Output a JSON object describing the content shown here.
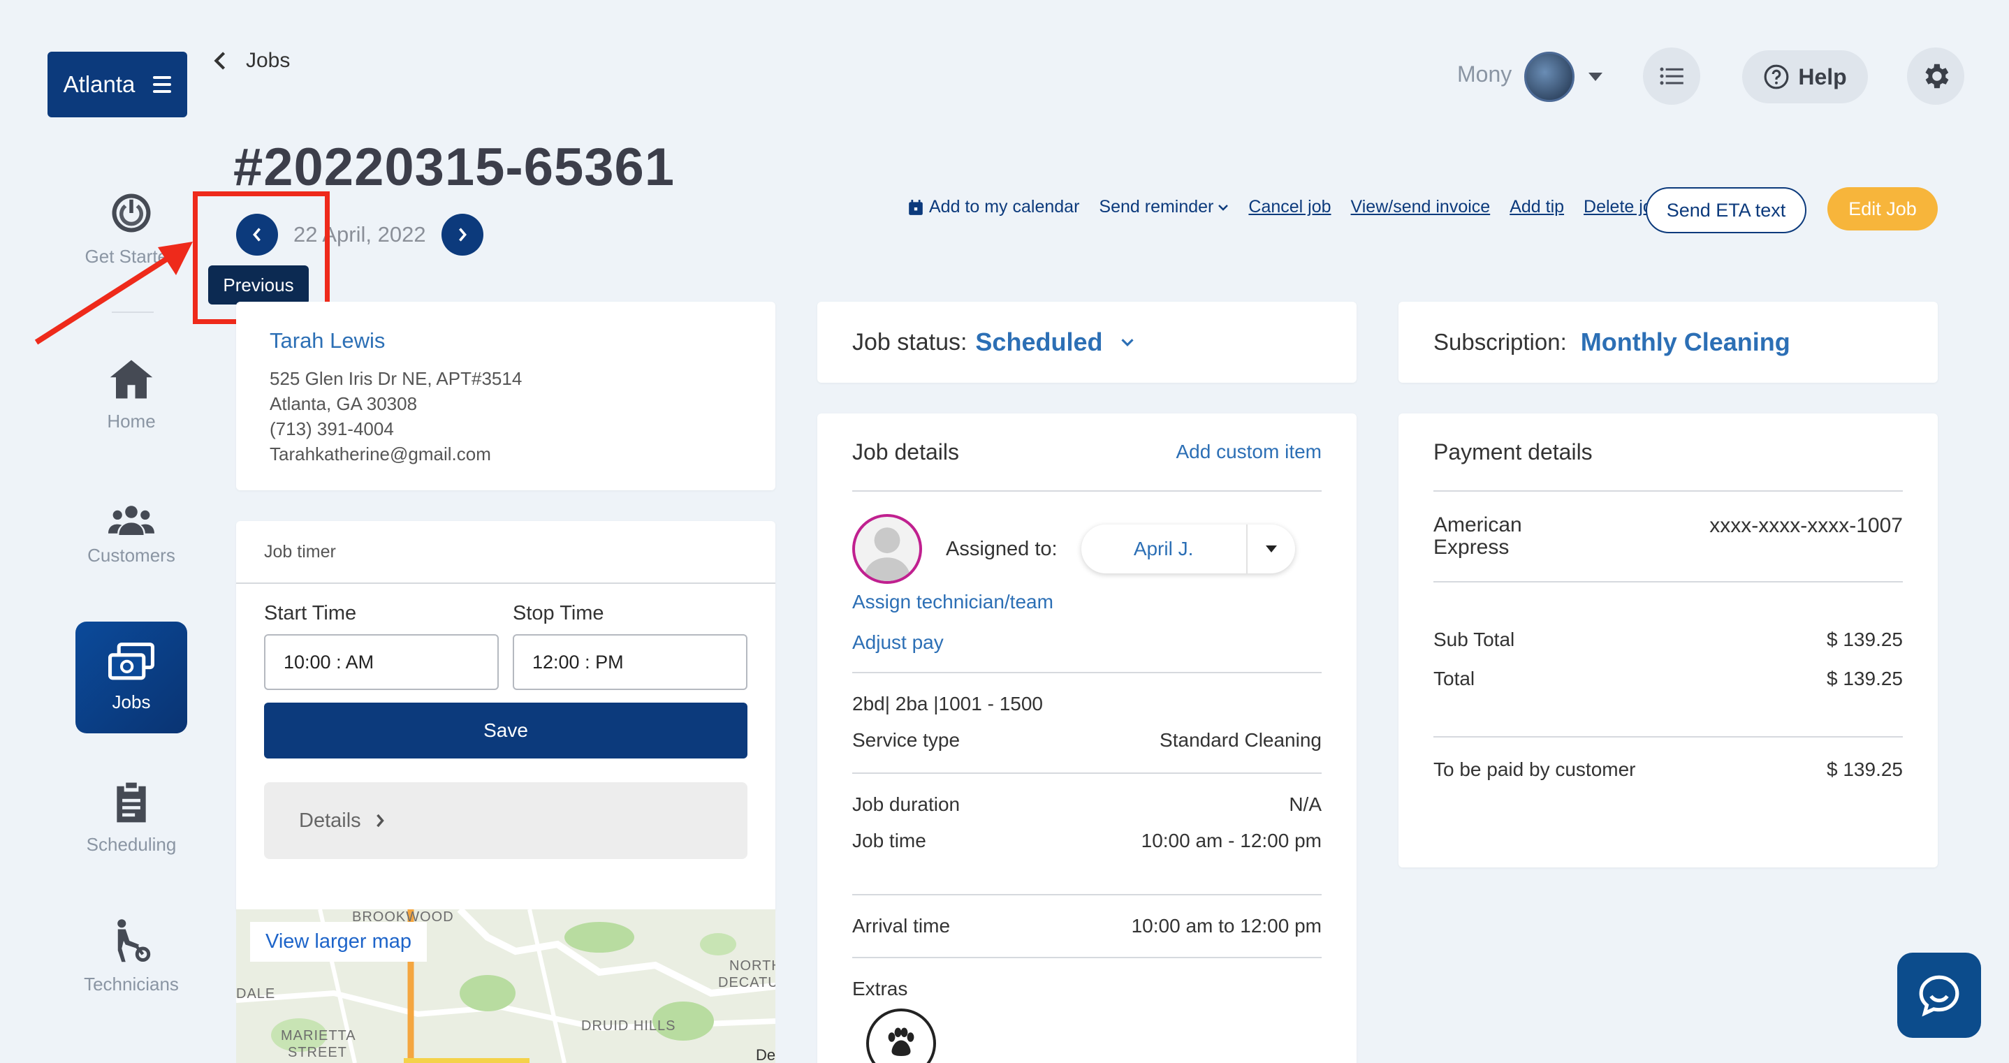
{
  "brand": {
    "label": "Atlanta",
    "icon": "menu-icon"
  },
  "sidebar": {
    "items": [
      {
        "label": "Get Started",
        "icon": "power-icon"
      },
      {
        "label": "Home",
        "icon": "home-icon"
      },
      {
        "label": "Customers",
        "icon": "customers-icon"
      },
      {
        "label": "Jobs",
        "icon": "jobs-icon",
        "active": true
      },
      {
        "label": "Scheduling",
        "icon": "clipboard-icon"
      },
      {
        "label": "Technicians",
        "icon": "technician-icon"
      }
    ]
  },
  "header": {
    "back_label": "Jobs",
    "user_name": "Mony",
    "help_label": "Help"
  },
  "job": {
    "id": "#20220315-65361",
    "date": "22 April, 2022",
    "tooltip": "Previous"
  },
  "actions": {
    "add_calendar": "Add to my calendar",
    "send_reminder": "Send reminder",
    "cancel_job": "Cancel job",
    "view_invoice": "View/send invoice",
    "add_tip": "Add tip",
    "delete_job": "Delete job",
    "send_eta": "Send ETA text",
    "edit_job": "Edit Job"
  },
  "customer": {
    "name": "Tarah Lewis",
    "address1": "525 Glen Iris Dr NE, APT#3514",
    "address2": "Atlanta, GA 30308",
    "phone": "(713) 391-4004",
    "email": "Tarahkatherine@gmail.com"
  },
  "timer": {
    "title": "Job timer",
    "start_label": "Start Time",
    "start_value": "10:00 : AM",
    "stop_label": "Stop Time",
    "stop_value": "12:00 : PM",
    "save_label": "Save",
    "details_label": "Details"
  },
  "map": {
    "link": "View larger map",
    "labels": [
      "BROOKWOOD",
      "DALE",
      "NORTH",
      "DECATU",
      "DRUID HILLS",
      "MARIETTA",
      "STREET",
      "De"
    ]
  },
  "status": {
    "label": "Job status:",
    "value": "Scheduled"
  },
  "job_details": {
    "title": "Job details",
    "add_custom": "Add custom item",
    "assigned_label": "Assigned to:",
    "assigned_value": "April J.",
    "assign_link": "Assign technician/team",
    "adjust_pay": "Adjust pay",
    "size": "2bd| 2ba |1001 - 1500",
    "service_type_label": "Service type",
    "service_type_value": "Standard Cleaning",
    "duration_label": "Job duration",
    "duration_value": "N/A",
    "time_label": "Job time",
    "time_value": "10:00 am - 12:00 pm",
    "arrival_label": "Arrival time",
    "arrival_value": "10:00 am to 12:00 pm",
    "extras_label": "Extras"
  },
  "subscription": {
    "label": "Subscription:",
    "value": "Monthly Cleaning"
  },
  "payment": {
    "title": "Payment details",
    "card_type_line1": "American",
    "card_type_line2": "Express",
    "card_number": "xxxx-xxxx-xxxx-1007",
    "subtotal_label": "Sub Total",
    "subtotal_value": "$ 139.25",
    "total_label": "Total",
    "total_value": "$ 139.25",
    "customer_pays_label": "To be paid by customer",
    "customer_pays_value": "$ 139.25"
  },
  "colors": {
    "primary": "#0c3a7c",
    "accent": "#f7b53b",
    "link": "#2c6fb5",
    "highlight": "#ee2a1b"
  }
}
